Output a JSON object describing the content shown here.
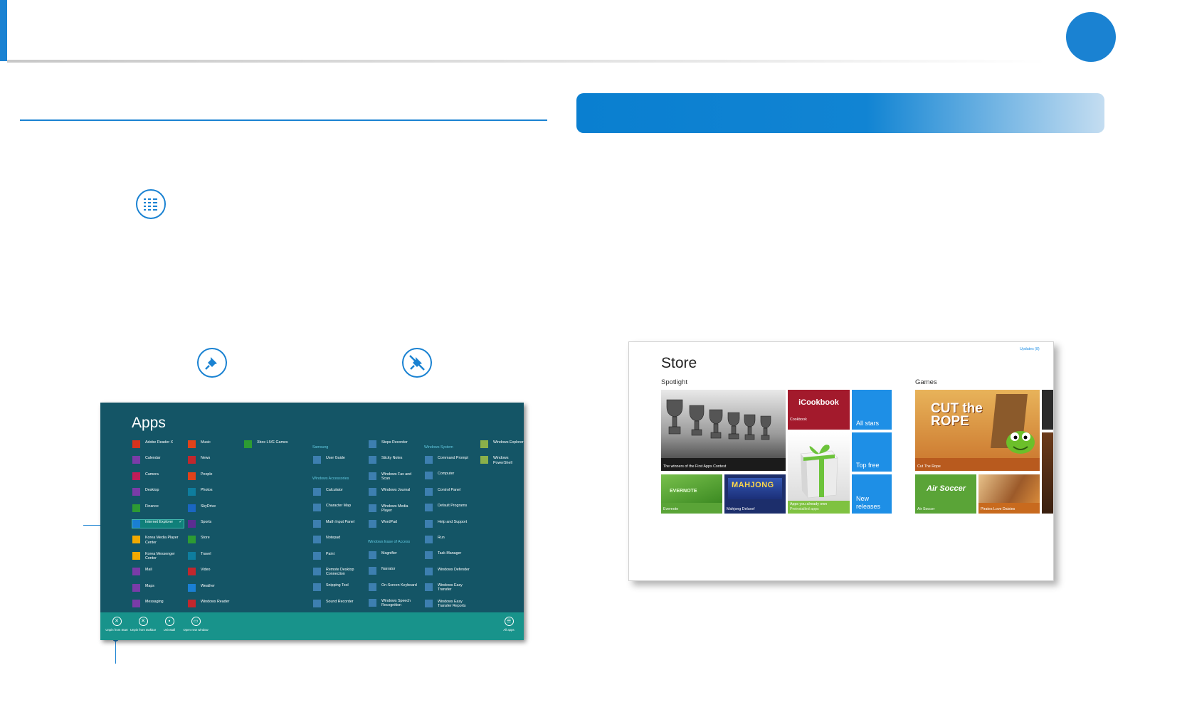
{
  "apps_screen": {
    "title": "Apps",
    "columns": [
      [
        {
          "label": "Adobe Reader X",
          "color": "#d6331d"
        },
        {
          "label": "Calendar",
          "color": "#7a3ca8"
        },
        {
          "label": "Camera",
          "color": "#c11d58"
        },
        {
          "label": "Desktop",
          "color": "#7a3ca8"
        },
        {
          "label": "Finance",
          "color": "#2d9b33"
        },
        {
          "label": "Internet Explorer",
          "color": "#1a7fd4",
          "selected": true
        },
        {
          "label": "Korea Media Player Center",
          "color": "#f2a900"
        },
        {
          "label": "Korea Messenger Center",
          "color": "#f2a900"
        },
        {
          "label": "Mail",
          "color": "#7a3ca8"
        },
        {
          "label": "Maps",
          "color": "#7a3ca8"
        },
        {
          "label": "Messaging",
          "color": "#7a3ca8"
        }
      ],
      [
        {
          "label": "Music",
          "color": "#e0421a"
        },
        {
          "label": "News",
          "color": "#c1272d"
        },
        {
          "label": "People",
          "color": "#e0421a"
        },
        {
          "label": "Photos",
          "color": "#0e7d9e"
        },
        {
          "label": "SkyDrive",
          "color": "#1a66c2"
        },
        {
          "label": "Sports",
          "color": "#5c2d91"
        },
        {
          "label": "Store",
          "color": "#2d9b33"
        },
        {
          "label": "Travel",
          "color": "#0e7d9e"
        },
        {
          "label": "Video",
          "color": "#c1272d"
        },
        {
          "label": "Weather",
          "color": "#1a7fd4"
        },
        {
          "label": "Windows Reader",
          "color": "#c1272d"
        }
      ],
      [
        {
          "label": "Xbox LIVE Games",
          "color": "#2d9b33"
        }
      ]
    ],
    "groups": [
      {
        "label": "Samsung",
        "items": [
          "User Guide"
        ]
      },
      {
        "label": "Windows Accessories",
        "items": [
          "Calculator",
          "Character Map",
          "Math Input Panel",
          "Notepad",
          "Paint",
          "Remote Desktop Connection",
          "Snipping Tool",
          "Sound Recorder"
        ]
      }
    ],
    "column5": [
      "Steps Recorder",
      "Sticky Notes",
      "Windows Fax and Scan",
      "Windows Journal",
      "Windows Media Player",
      "WordPad"
    ],
    "ease_group": {
      "label": "Windows Ease of Access",
      "items": [
        "Magnifier",
        "Narrator",
        "On-Screen Keyboard",
        "Windows Speech Recognition"
      ]
    },
    "system_group": {
      "label": "Windows System",
      "items": [
        "Command Prompt",
        "Computer",
        "Control Panel",
        "Default Programs",
        "Help and Support",
        "Run",
        "Task Manager",
        "Windows Defender",
        "Windows Easy Transfer",
        "Windows Easy Transfer Reports"
      ]
    },
    "column7": [
      "Windows Explorer",
      "Windows PowerShell"
    ],
    "app_bar": {
      "buttons": [
        "Unpin from Start",
        "Unpin from taskbar",
        "Uninstall",
        "Open new window"
      ],
      "all_apps": "All apps"
    }
  },
  "store_screen": {
    "title": "Store",
    "updates": "Updates (8)",
    "spotlight_heading": "Spotlight",
    "games_heading": "Games",
    "tiles": {
      "contest": "The winners of the First Apps Contest",
      "cookbook_logo": "iCookbook",
      "cookbook": "Cookbook",
      "all_stars": "All stars",
      "top_free": "Top free",
      "new_releases": "New releases",
      "evernote_logo": "EVERNOTE",
      "evernote": "Evernote",
      "mahjong_logo": "MAHJONG",
      "mahjong": "Mahjong Deluxe!",
      "owned": "Apps you already own",
      "owned_sub": "Preinstalled apps",
      "cut_rope_logo": "CUT the ROPE",
      "cut_rope": "Cut The Rope",
      "air_soccer_logo": "Air Soccer",
      "air_soccer": "Air Soccer",
      "pirates": "Pirates Love Daisies"
    }
  },
  "colors": {
    "accent": "#1a82d2",
    "apps_bg": "#145566",
    "apps_bar": "#18938b",
    "store_blue": "#1e8fe6"
  }
}
